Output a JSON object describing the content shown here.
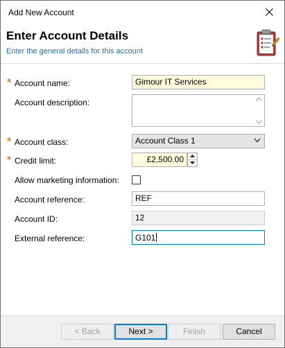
{
  "window": {
    "title": "Add New Account",
    "close_glyph": "✕"
  },
  "header": {
    "title": "Enter Account Details",
    "subtitle": "Enter the general details for this account",
    "icon": "clipboard-checklist-icon"
  },
  "form": {
    "required_marker": "*",
    "account_name": {
      "label": "Account name:",
      "value": "Gimour IT Services",
      "required": true
    },
    "account_description": {
      "label": "Account description:",
      "value": ""
    },
    "account_class": {
      "label": "Account class:",
      "value": "Account Class 1",
      "required": true
    },
    "credit_limit": {
      "label": "Credit limit:",
      "value": "£2,500.00",
      "required": true
    },
    "allow_marketing": {
      "label": "Allow marketing information:",
      "checked": false
    },
    "account_reference": {
      "label": "Account reference:",
      "value": "REF"
    },
    "account_id": {
      "label": "Account ID:",
      "value": "12"
    },
    "external_reference": {
      "label": "External reference:",
      "value": "G101"
    }
  },
  "footer": {
    "back_label": "< Back",
    "next_label": "Next >",
    "finish_label": "Finish",
    "cancel_label": "Cancel"
  },
  "colors": {
    "required": "#e8862a",
    "subtitle": "#1f6fb5",
    "highlight_field": "#fffbdd",
    "focus": "#0078d7"
  }
}
